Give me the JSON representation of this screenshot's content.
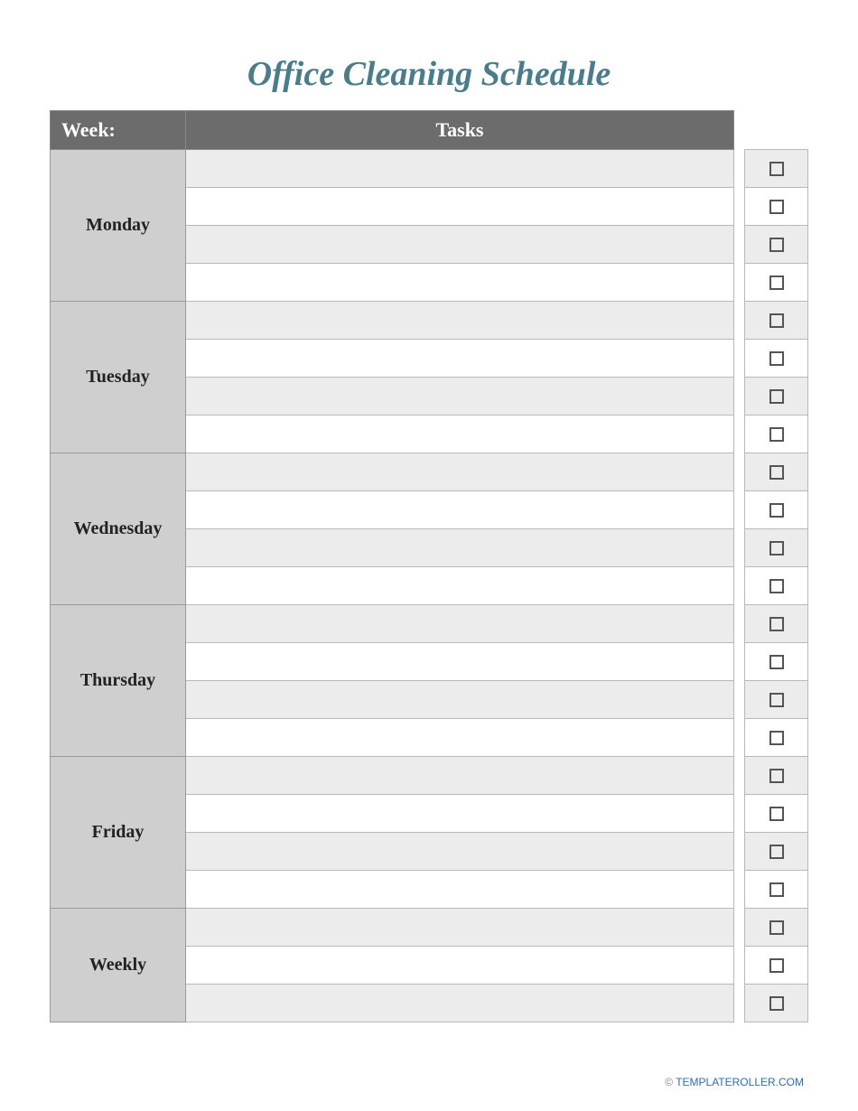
{
  "title": "Office Cleaning Schedule",
  "header": {
    "week_label": "Week:",
    "tasks_label": "Tasks"
  },
  "days": [
    {
      "name": "Monday",
      "rows": 4,
      "tasks": [
        "",
        "",
        "",
        ""
      ]
    },
    {
      "name": "Tuesday",
      "rows": 4,
      "tasks": [
        "",
        "",
        "",
        ""
      ]
    },
    {
      "name": "Wednesday",
      "rows": 4,
      "tasks": [
        "",
        "",
        "",
        ""
      ]
    },
    {
      "name": "Thursday",
      "rows": 4,
      "tasks": [
        "",
        "",
        "",
        ""
      ]
    },
    {
      "name": "Friday",
      "rows": 4,
      "tasks": [
        "",
        "",
        "",
        ""
      ]
    },
    {
      "name": "Weekly",
      "rows": 3,
      "tasks": [
        "",
        "",
        ""
      ]
    }
  ],
  "footer": {
    "copyright": "© ",
    "link_text": "TEMPLATEROLLER.COM"
  }
}
